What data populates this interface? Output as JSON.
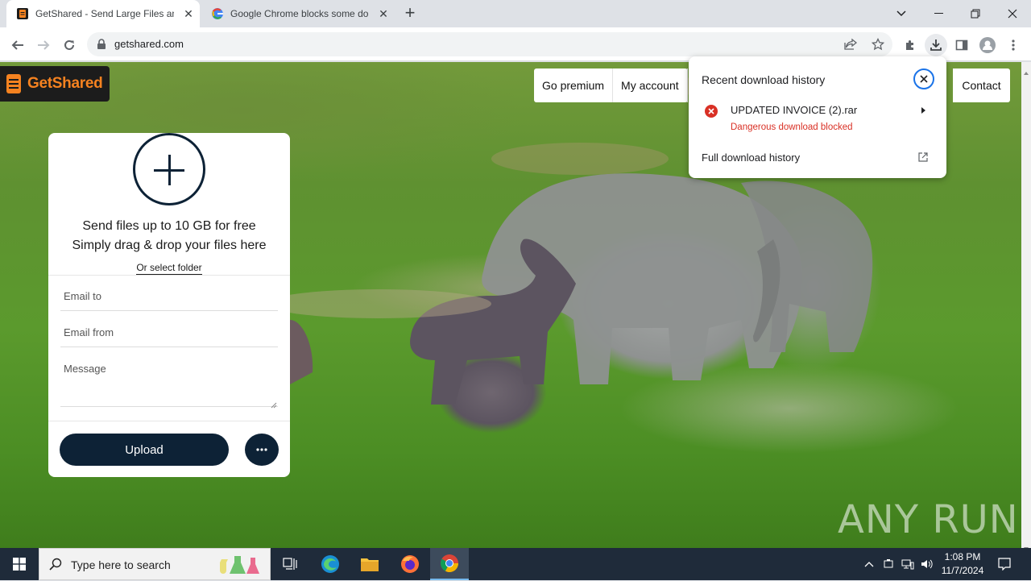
{
  "browser": {
    "tabs": [
      {
        "title": "GetShared - Send Large Files and",
        "active": true,
        "favicon": "getshared-favicon"
      },
      {
        "title": "Google Chrome blocks some do",
        "active": false,
        "favicon": "google-favicon"
      }
    ],
    "url": "getshared.com"
  },
  "site": {
    "logo_text": "GetShared",
    "nav": [
      "Go premium",
      "My account"
    ],
    "contact_label": "Contact"
  },
  "upload_card": {
    "headline": "Send files up to 10 GB for free",
    "subline": "Simply drag & drop your files here",
    "select_folder": "Or select folder",
    "email_to_placeholder": "Email to",
    "email_from_placeholder": "Email from",
    "message_placeholder": "Message",
    "upload_label": "Upload"
  },
  "download_bubble": {
    "title": "Recent download history",
    "file_name": "UPDATED INVOICE (2).rar",
    "status": "Dangerous download blocked",
    "full_history_label": "Full download history",
    "status_color": "#d93025"
  },
  "watermark": "ANY RUN",
  "taskbar": {
    "search_placeholder": "Type here to search",
    "time": "1:08 PM",
    "date": "11/7/2024"
  }
}
